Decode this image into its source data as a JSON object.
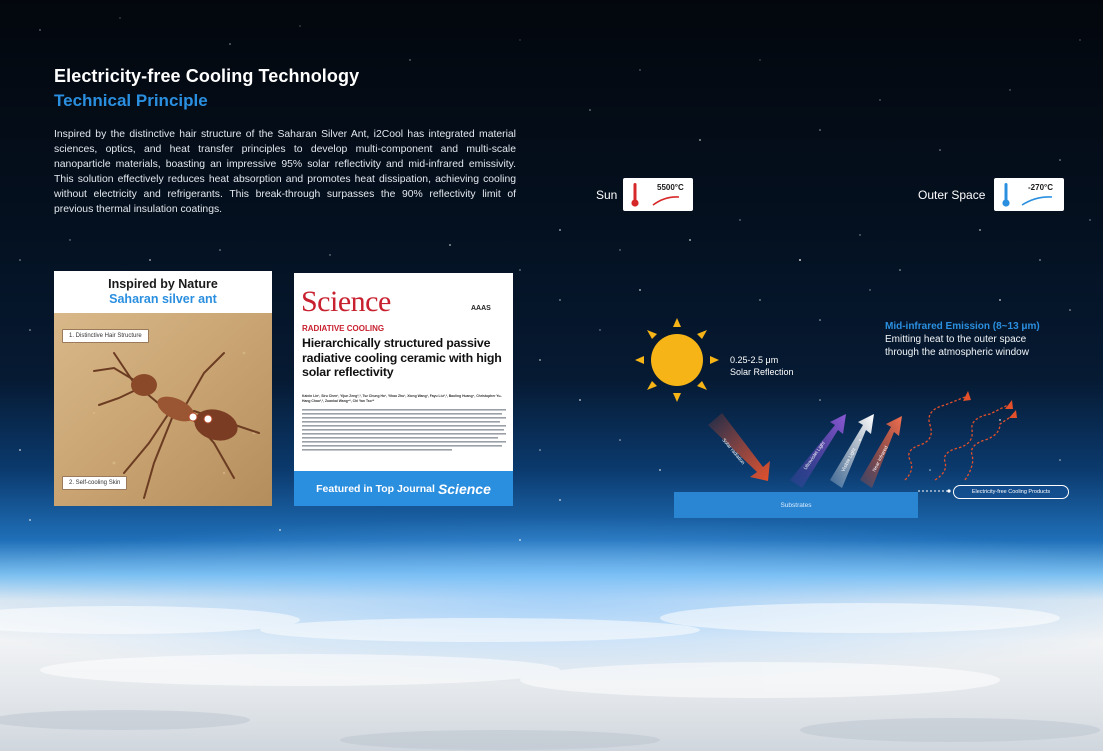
{
  "header": {
    "title": "Electricity-free Cooling Technology",
    "subtitle": "Technical Principle"
  },
  "intro_text": "Inspired by the distinctive hair structure of the Saharan Silver Ant, i2Cool has integrated material sciences, optics, and heat transfer principles to develop multi-component and multi-scale nanoparticle materials, boasting an impressive 95% solar reflectivity and mid-infrared emissivity. This solution effectively reduces heat absorption and promotes heat dissipation, achieving cooling without electricity and refrigerants. This break-through surpasses the 90% reflectivity limit of previous thermal insulation coatings.",
  "ant_card": {
    "heading": "Inspired by Nature",
    "subheading": "Saharan silver ant",
    "label_1": "1. Distinctive Hair Structure",
    "label_2": "2. Self-cooling Skin"
  },
  "science_card": {
    "logo": "Science",
    "publisher": "AAAS",
    "category": "RADIATIVE COOLING",
    "title": "Hierarchically structured passive radiative cooling ceramic with high solar reflectivity",
    "authors": "Kaixin Lin¹, Siru Chen¹, Yijun Zeng²,³, Tsz Chung Ho¹, Yihao Zhu¹, Xiong Wang¹, Fayu Liu²,³, Baoling Huang⁴, Christopher Yu-Hang Chao²,³, Zuankai Wang⁵*, Chi Yan Tso¹*",
    "band_text": "Featured in Top Journal",
    "band_em": "Science"
  },
  "sun": {
    "label": "Sun",
    "temperature": "5500°C",
    "thermometer_color": "#d62828"
  },
  "space": {
    "label": "Outer Space",
    "temperature": "-270°C",
    "thermometer_color": "#2b8fe0"
  },
  "solar_reflection": {
    "range": "0.25-2.5 μm",
    "label": "Solar Reflection"
  },
  "mid_infrared": {
    "heading": "Mid-infrared Emission (8~13 μm)",
    "line1": "Emitting heat to the outer space",
    "line2": "through the atmospheric window"
  },
  "arrows": {
    "incoming": "Solar radiation",
    "uv": "Ultraviolet Light",
    "visible": "Visible Light",
    "nir": "Near Infrared"
  },
  "substrate_label": "Substrates",
  "product_label": "Electricity-free Cooling Products",
  "colors": {
    "accent_blue": "#2b8fe0",
    "science_red": "#c8202e",
    "sun_yellow": "#f6b417",
    "arrow_orange": "#e3502a"
  }
}
